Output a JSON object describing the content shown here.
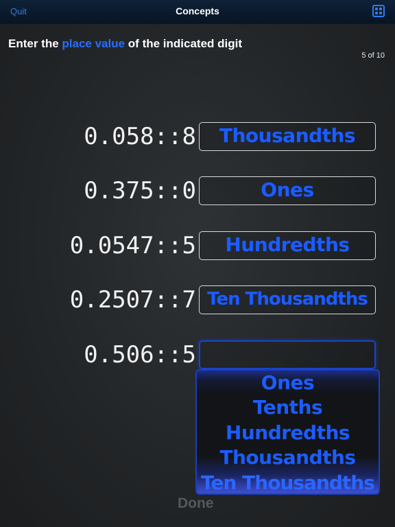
{
  "navbar": {
    "quit_label": "Quit",
    "title": "Concepts",
    "menu_icon": "grid-icon"
  },
  "instruction": {
    "prefix": "Enter the ",
    "highlight": "place value",
    "suffix": " of the indicated digit"
  },
  "progress": "5 of 10",
  "problems": [
    {
      "number": "0.058::8",
      "answer": "Thousandths"
    },
    {
      "number": "0.375::0",
      "answer": "Ones"
    },
    {
      "number": "0.0547::5",
      "answer": "Hundredths"
    },
    {
      "number": "0.2507::7",
      "answer": "Ten Thousandths"
    },
    {
      "number": "0.506::5",
      "answer": ""
    }
  ],
  "picker": {
    "options": [
      "Ones",
      "Tenths",
      "Hundredths",
      "Thousandths",
      "Ten Thousandths"
    ],
    "selected": "Ten Thousandths"
  },
  "done_label": "Done",
  "colors": {
    "accent": "#1c5cff",
    "nav_link": "#3b78d8",
    "background": "#232628"
  }
}
